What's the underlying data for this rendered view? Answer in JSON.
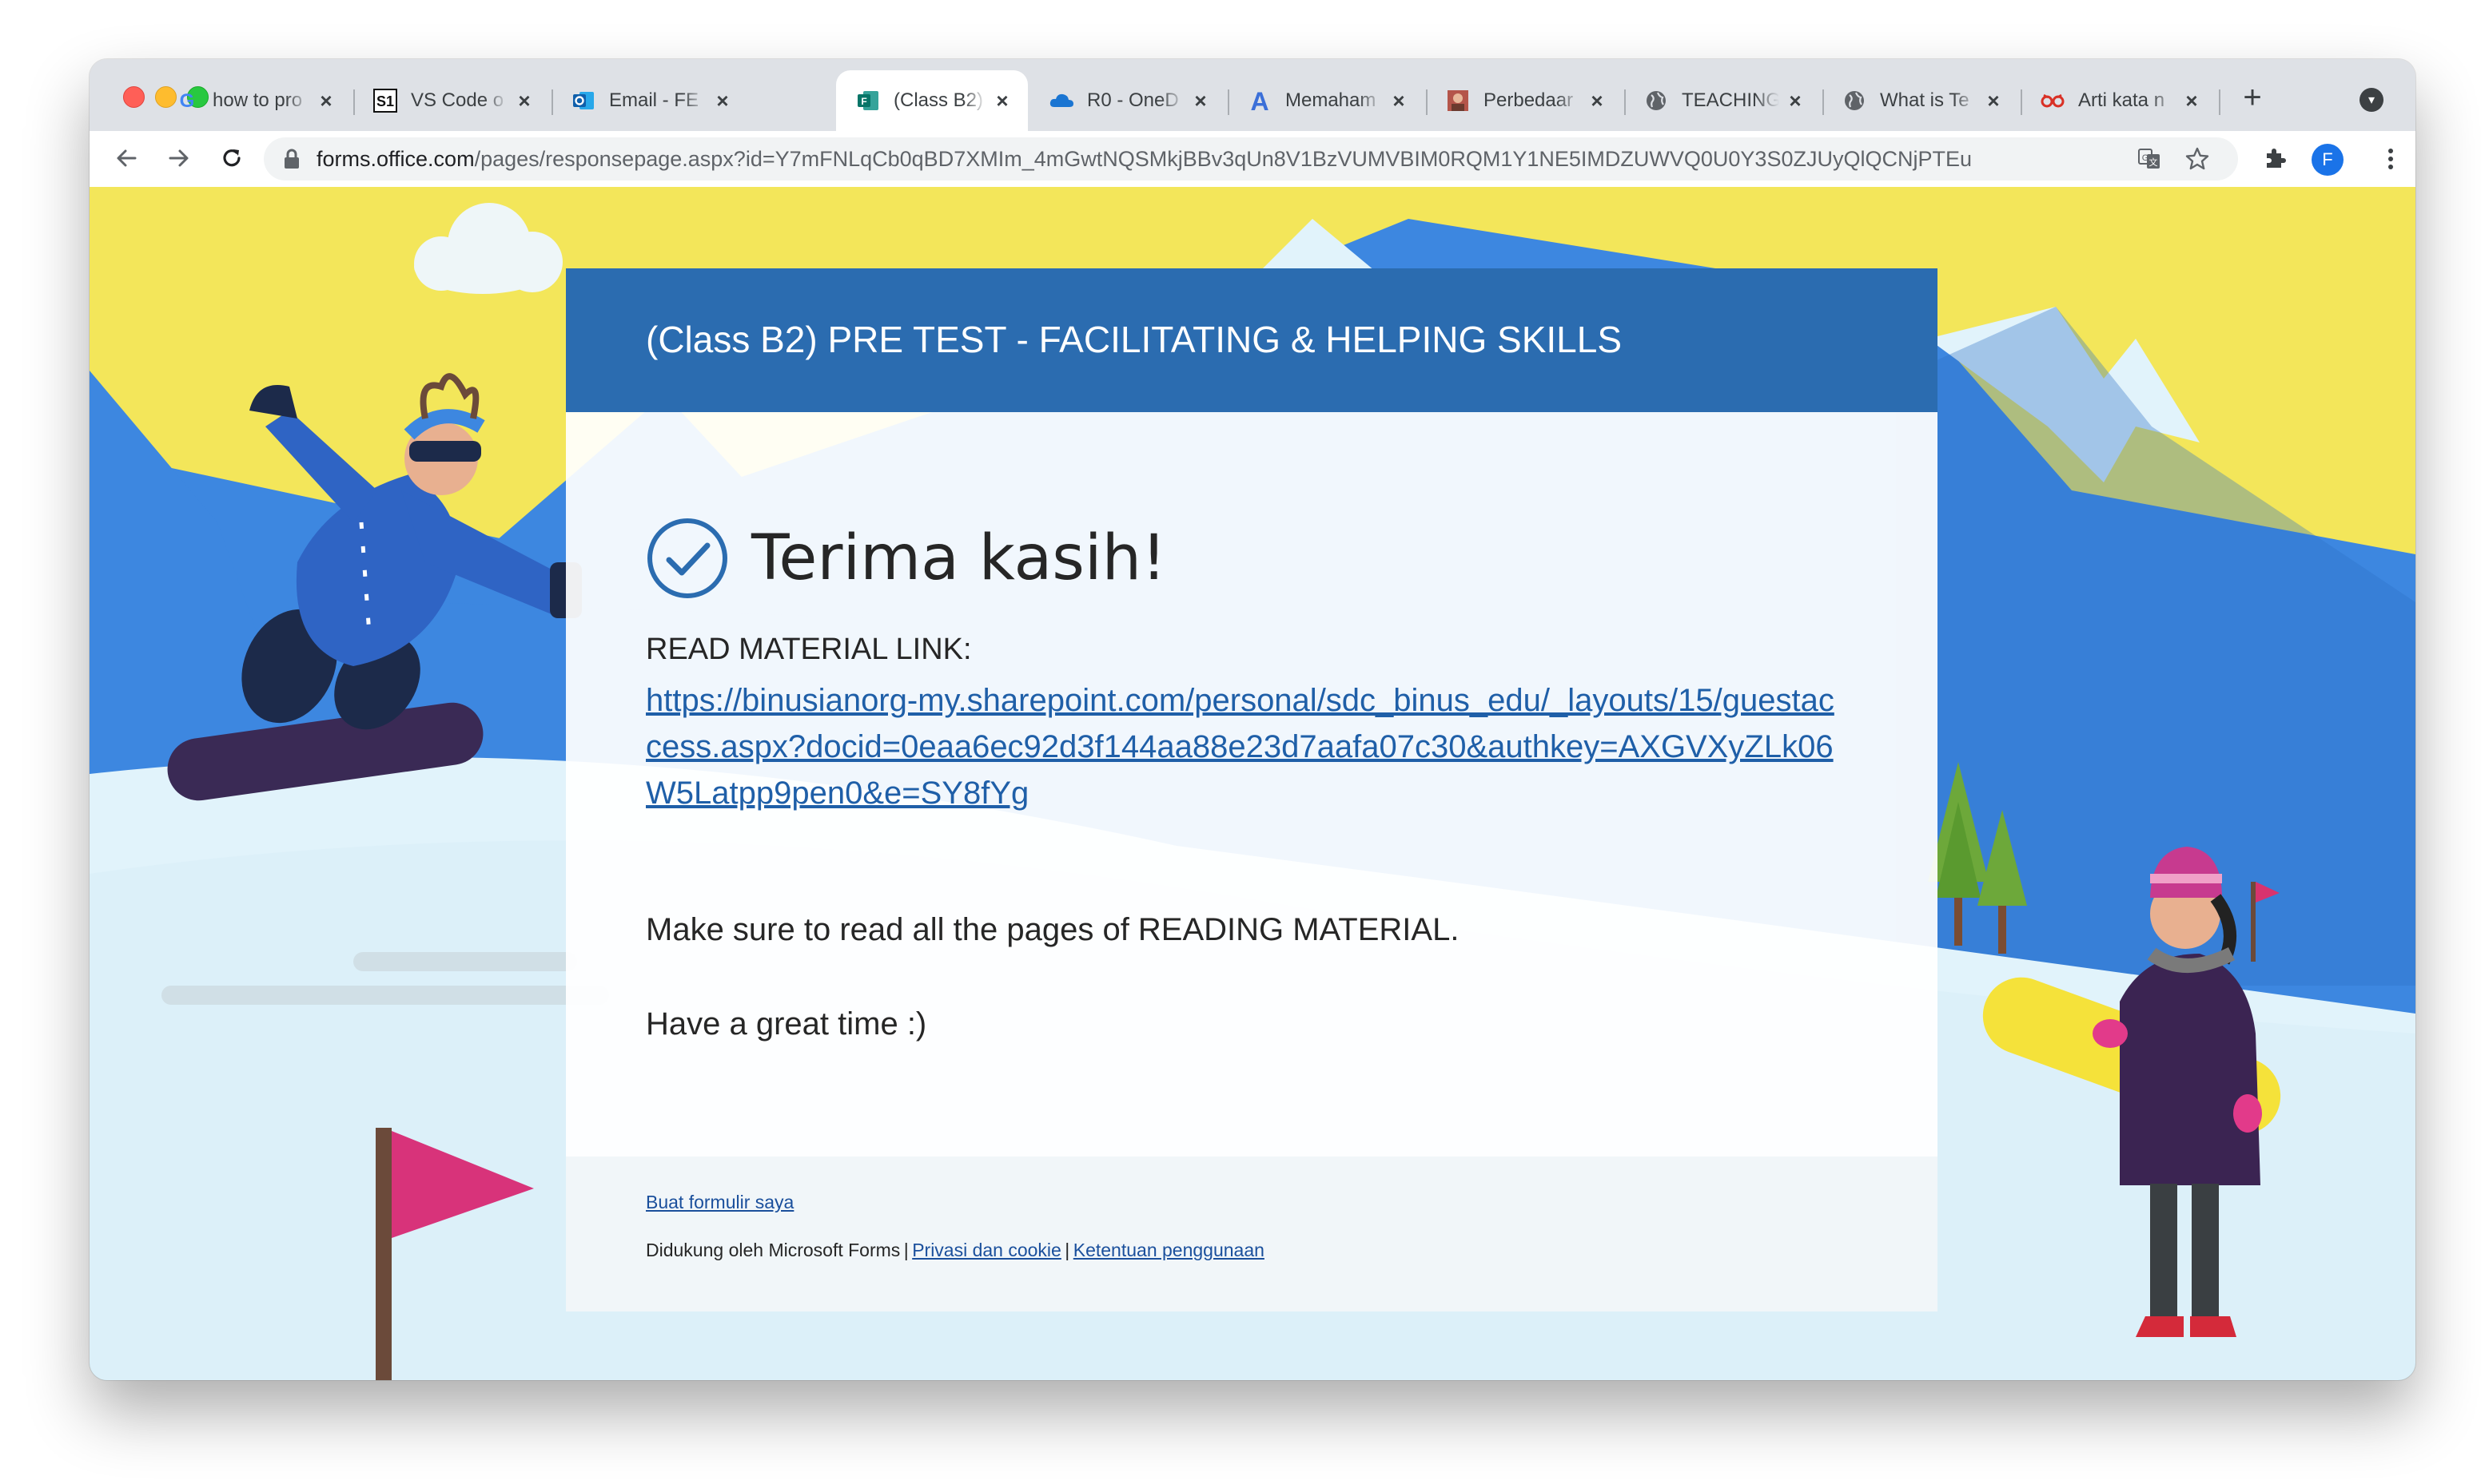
{
  "browser": {
    "tabs": [
      {
        "title": "how to pro",
        "icon": "google-icon"
      },
      {
        "title": "VS Code o",
        "icon": "s1-icon"
      },
      {
        "title": "Email - FE",
        "icon": "outlook-icon"
      },
      {
        "title": "(Class B2)",
        "icon": "forms-icon",
        "active": true
      },
      {
        "title": "R0 - OneD",
        "icon": "onedrive-icon"
      },
      {
        "title": "Memaham",
        "icon": "letter-a-icon"
      },
      {
        "title": "Perbedaar",
        "icon": "photo-icon"
      },
      {
        "title": "TEACHING",
        "icon": "globe-icon"
      },
      {
        "title": "What is Te",
        "icon": "globe-icon"
      },
      {
        "title": "Arti kata n",
        "icon": "infinity-icon"
      }
    ],
    "tab_close_glyph": "×",
    "new_tab_glyph": "+",
    "address": {
      "host": "forms.office.com",
      "path": "/pages/responsepage.aspx?id=Y7mFNLqCb0qBD7XMIm_4mGwtNQSMkjBBv3qUn8V1BzVUMVBIM0RQM1Y1NE5IMDZUWVQ0U0Y3S0ZJUyQlQCNjPTEu"
    },
    "profile_initial": "F"
  },
  "form": {
    "title": "(Class B2) PRE TEST - FACILITATING & HELPING SKILLS",
    "thanks": "Terima kasih!",
    "label": "READ MATERIAL LINK:",
    "link": "https://binusianorg-my.sharepoint.com/personal/sdc_binus_edu/_layouts/15/guestaccess.aspx?docid=0eaa6ec92d3f144aa88e23d7aafa07c30&authkey=AXGVXyZLk06W5Latpp9pen0&e=SY8fYg",
    "message1": "Make sure to read all the pages of READING MATERIAL.",
    "message2": "Have a great time :)"
  },
  "footer": {
    "create_link": "Buat formulir saya",
    "powered_by": "Didukung oleh Microsoft Forms",
    "separator": "|",
    "privacy_link": "Privasi dan cookie",
    "terms_link": "Ketentuan penggunaan"
  },
  "colors": {
    "header": "#2b6cb0",
    "sky": "#f3e65a",
    "mountain": "#3d87e0",
    "snow": "#e1f3fb"
  }
}
